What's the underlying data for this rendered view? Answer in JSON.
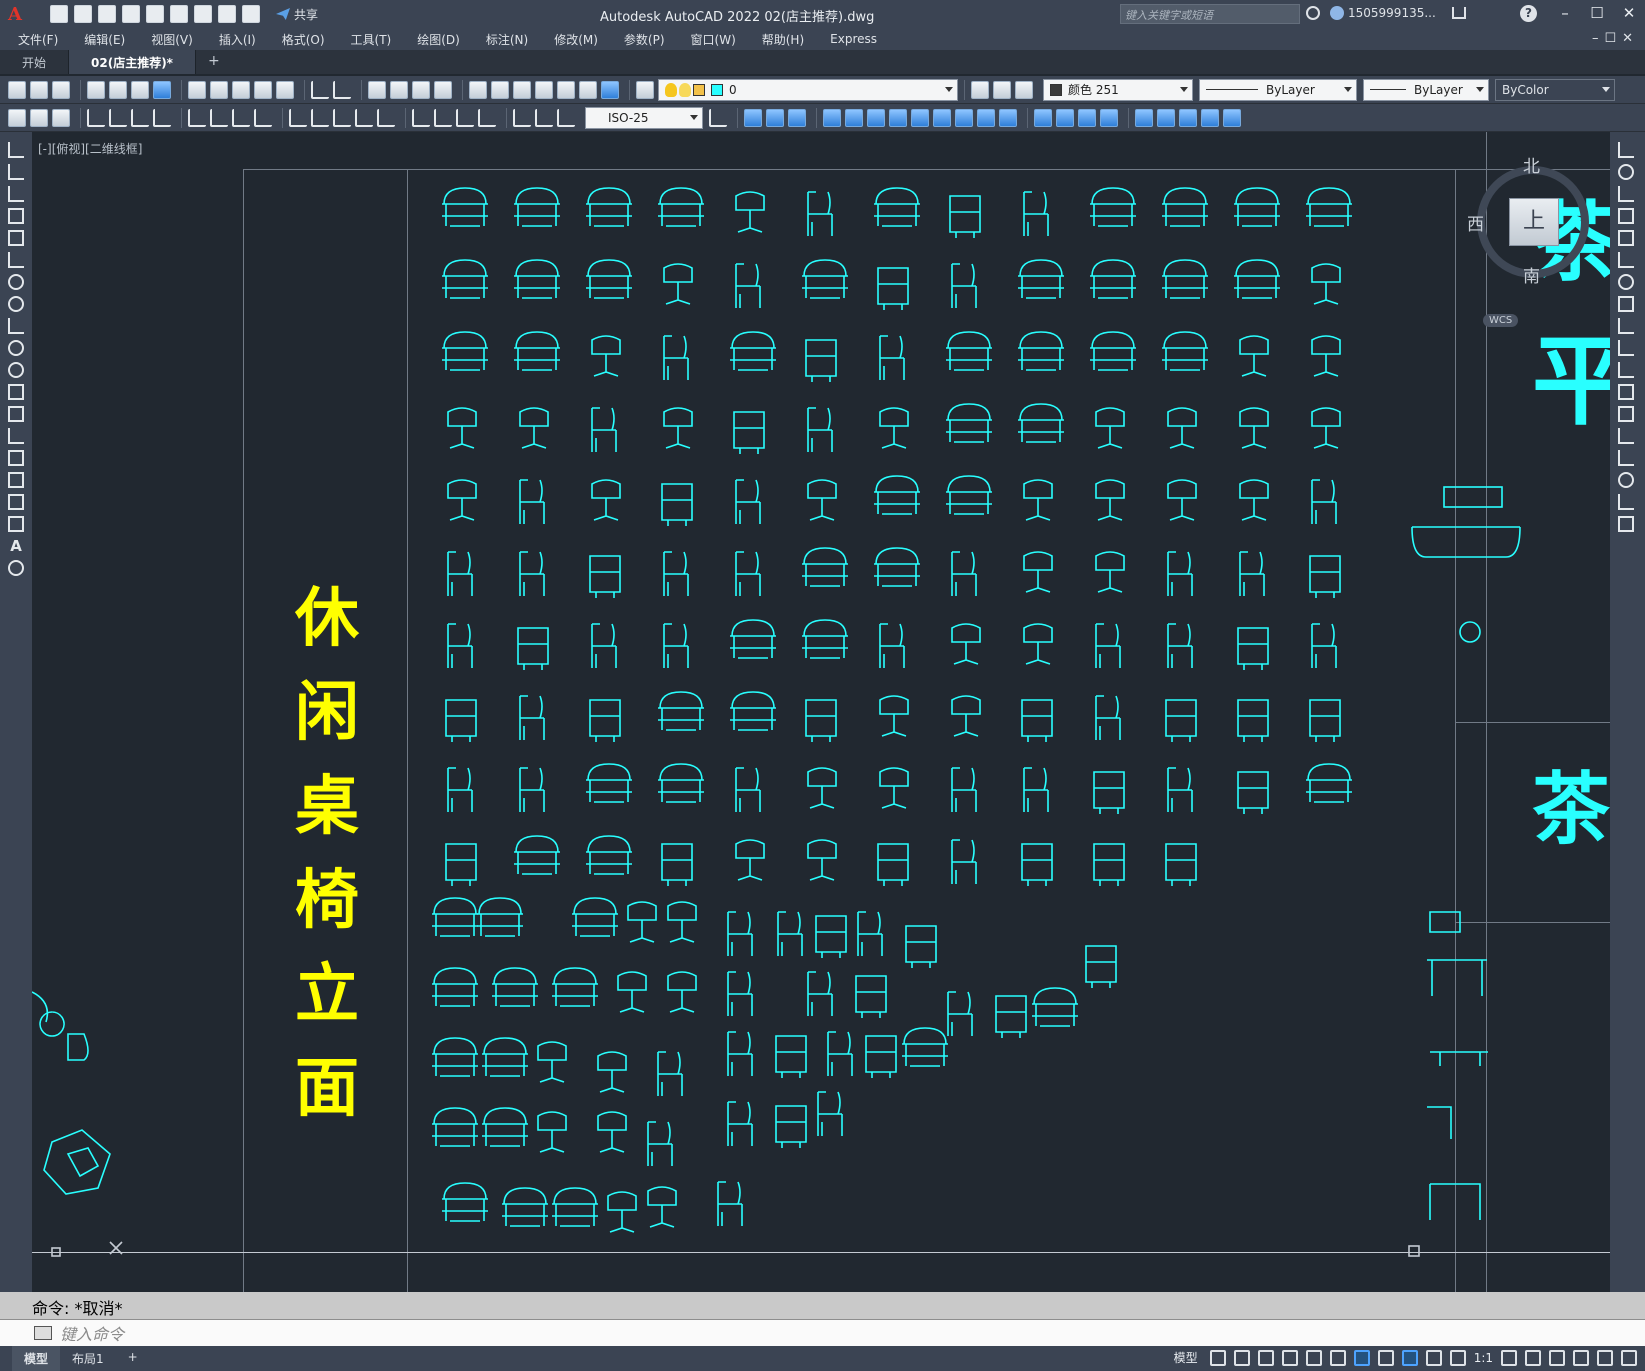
{
  "titlebar": {
    "app_title": "Autodesk AutoCAD 2022    02(店主推荐).dwg",
    "share_label": "共享",
    "search_placeholder": "键入关键字或短语",
    "user_label": "1505999135...",
    "win_minimize": "–",
    "win_maximize": "☐",
    "win_close": "✕"
  },
  "menubar": {
    "items": [
      "文件(F)",
      "编辑(E)",
      "视图(V)",
      "插入(I)",
      "格式(O)",
      "工具(T)",
      "绘图(D)",
      "标注(N)",
      "修改(M)",
      "参数(P)",
      "窗口(W)",
      "帮助(H)",
      "Express"
    ],
    "window_controls": "–☐✕"
  },
  "tabs": {
    "items": [
      {
        "label": "开始",
        "active": false
      },
      {
        "label": "02(店主推荐)*",
        "active": true
      }
    ],
    "add_label": "+"
  },
  "toolbar": {
    "layer_value": "0",
    "color_value": "颜色 251",
    "linetype_value": "ByLayer",
    "lineweight_value": "ByLayer",
    "plotstyle_value": "ByColor",
    "dimstyle_value": "ISO-25"
  },
  "drawing": {
    "view_label": "[-][俯视][二维线框]",
    "vertical_title": [
      "休",
      "闲",
      "桌",
      "椅",
      "立",
      "面"
    ],
    "side_text_1": "茶",
    "side_text_2": "平",
    "side_text_3": "茶",
    "accent_color": "#29ffff",
    "title_color": "#ffff00"
  },
  "viewcube": {
    "north": "北",
    "south": "南",
    "west": "西",
    "face": "上",
    "wcs_label": "WCS"
  },
  "commandline": {
    "history": "命令:  *取消*",
    "placeholder": "键入命令"
  },
  "statusbar": {
    "layouts": [
      {
        "label": "模型",
        "active": true
      },
      {
        "label": "布局1",
        "active": false
      }
    ],
    "add_layout": "+",
    "model_label": "模型",
    "scale_label": "1:1"
  }
}
